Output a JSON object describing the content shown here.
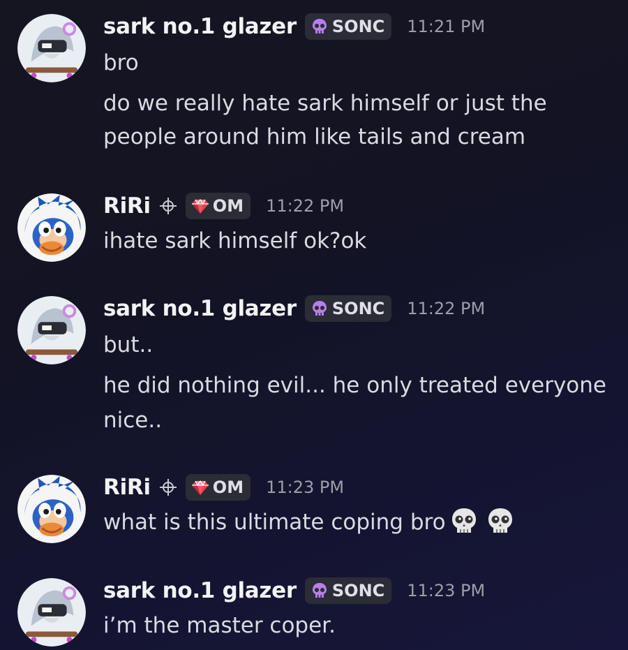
{
  "messages": [
    {
      "author": "sark no.1 glazer",
      "tag": "SONC",
      "time": "11:21 PM",
      "lines": [
        "bro",
        "do we really hate sark himself or just the",
        "people around him like tails and cream"
      ]
    },
    {
      "author": "RiRi",
      "tag": "OM",
      "time": "11:22 PM",
      "lines": [
        "ihate sark himself ok?ok"
      ]
    },
    {
      "author": "sark no.1 glazer",
      "tag": "SONC",
      "time": "11:22 PM",
      "lines": [
        "but..",
        "he did nothing evil... he only treated everyone",
        "nice.."
      ]
    },
    {
      "author": "RiRi",
      "tag": "OM",
      "time": "11:23 PM",
      "lines": [
        "what is this ultimate coping bro"
      ],
      "emojis": [
        "skull-emoji",
        "skull-emoji"
      ]
    },
    {
      "author": "sark no.1 glazer",
      "tag": "SONC",
      "time": "11:23 PM",
      "lines": [
        "i’m the master coper."
      ]
    }
  ],
  "colors": {
    "background": "#141428",
    "username": "#f2f3f5",
    "message_text": "#d9dbe1",
    "timestamp": "#9d9fa8",
    "tag_background": "#2b2c36",
    "sonc_tag_icon": "#b57ee8",
    "om_tag_icon": "#e8404f"
  },
  "icons": {
    "sonc_tag": "purple-skull-icon",
    "om_tag": "ruby-gem-icon",
    "riri_badge": "crosshair-icon"
  }
}
